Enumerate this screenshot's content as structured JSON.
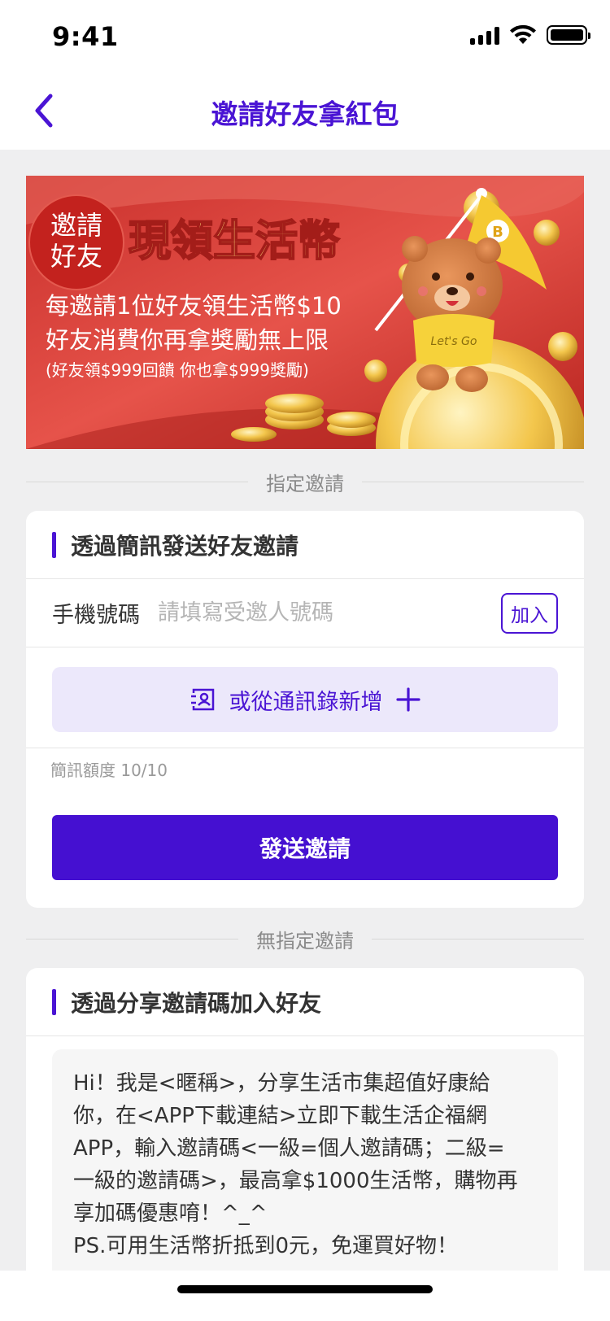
{
  "status_bar": {
    "time": "9:41"
  },
  "nav": {
    "title": "邀請好友拿紅包"
  },
  "banner": {
    "badge_line1": "邀請",
    "badge_line2": "好友",
    "headline": "現領生活幣",
    "line1": "每邀請1位好友領生活幣$10",
    "line2": "好友消費你再拿獎勵無上限",
    "line3": "(好友領$999回饋 你也拿$999獎勵)",
    "mascot_flag": "B",
    "mascot_shirt": "Let's Go"
  },
  "designated_invite": {
    "divider_label": "指定邀請",
    "card_title": "透過簡訊發送好友邀請",
    "phone_label": "手機號碼",
    "phone_placeholder": "請填寫受邀人號碼",
    "add_label": "加入",
    "contacts_label": "或從通訊錄新增",
    "quota_text": "簡訊額度 10/10",
    "send_label": "發送邀請"
  },
  "open_invite": {
    "divider_label": "無指定邀請",
    "card_title": "透過分享邀請碼加入好友",
    "message_lines": [
      "Hi！我是<暱稱>，分享生活市集超值好康給",
      "你，在<APP下載連結>立即下載生活企福網",
      "APP，輸入邀請碼<一級=個人邀請碼；二級=",
      "一級的邀請碼>，最高拿$1000生活幣，購物再",
      "享加碼優惠唷！^_^",
      "PS.可用生活幣折抵到0元，免運買好物！"
    ]
  },
  "colors": {
    "accent": "#4a14d4",
    "send_button": "#4510d1",
    "contacts_bg": "#ece8fb",
    "page_bg": "#efeff0"
  },
  "icons": {
    "back": "chevron-left-icon",
    "contacts": "contact-card-icon",
    "add": "plus-icon"
  }
}
